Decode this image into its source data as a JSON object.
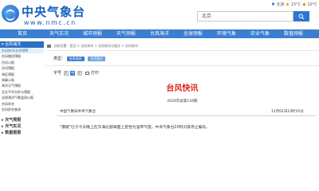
{
  "header": {
    "logo_text": "中央气象台",
    "logo_url": "www.nmc.cn",
    "search_placeholder": "北京",
    "city": "北京",
    "temp": "15°C",
    "top_tag": "10°C"
  },
  "nav": {
    "items": [
      "首页",
      "天气实况",
      "城市预报",
      "天气预报",
      "台风海洋",
      "全球预报",
      "环境气象",
      "农业气象",
      "数值预报"
    ]
  },
  "sidebar": {
    "section_title": "台风海洋",
    "items": [
      "台风快讯/台风预警",
      "台风路径预报",
      "台风公报",
      "台风预报",
      "海区预报",
      "海事公报",
      "海洋天气预报",
      "北太平洋分析与预报",
      "全球海洋气象监测公报",
      "台风命名",
      "台风综合查询"
    ],
    "active_index": 0,
    "groups": [
      "天气预报",
      "天气实况",
      "数据报报"
    ]
  },
  "main": {
    "breadcrumb": [
      "当前位置：",
      "首页",
      " > ",
      "台风海洋",
      " > ",
      "台风快讯与报文",
      " > ",
      "台风快讯"
    ],
    "type_label": "类型：",
    "type_chips": [
      "台风快讯",
      "台风报文"
    ],
    "font_label": "字号",
    "font_sizes": [
      "大",
      "中",
      "小"
    ],
    "print_label": "打印",
    "title": "台风快讯",
    "issue": "2024年总第134期",
    "publisher": "中国气象局中央气象台",
    "date": "11月01日23时35分",
    "content": "\"康妮\"已于今天晚上在东海北部海面上变性为温带气旋，中央气象台20时对其停止编号。"
  }
}
